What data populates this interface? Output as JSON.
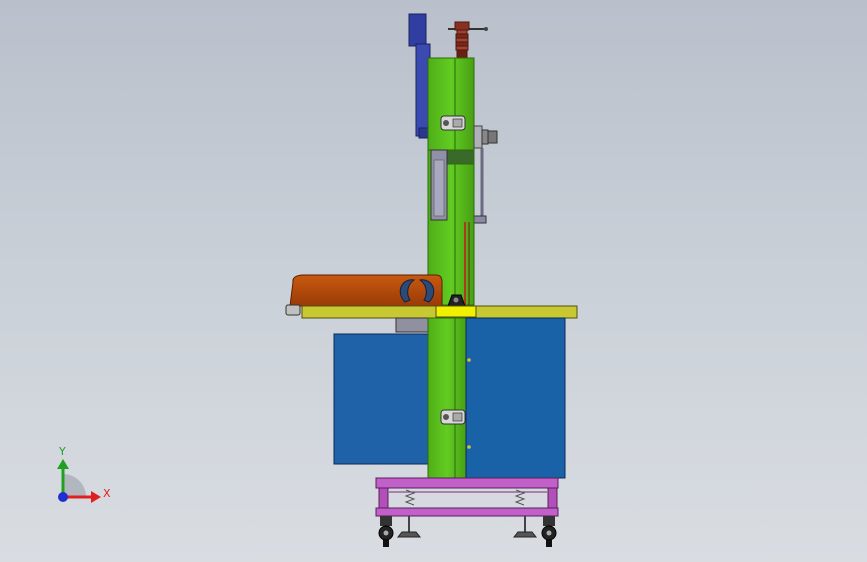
{
  "viewport": {
    "background_top": "#b9c0cb",
    "background_bottom": "#d9dde2"
  },
  "triad": {
    "x_label": "X",
    "y_label": "Y",
    "x_color": "#e02020",
    "y_color": "#20a020",
    "z_color": "#2030d0"
  },
  "model": {
    "colors": {
      "frame_green": "#5cc21d",
      "cabinet_blue": "#2062a8",
      "cabinet_blue_dark": "#1a5290",
      "table_yellow": "#c8c832",
      "blade_guard_blue": "#2f3ea0",
      "fence_orange": "#b84808",
      "base_purple": "#c060c8",
      "tension_brown": "#8a3020"
    }
  }
}
